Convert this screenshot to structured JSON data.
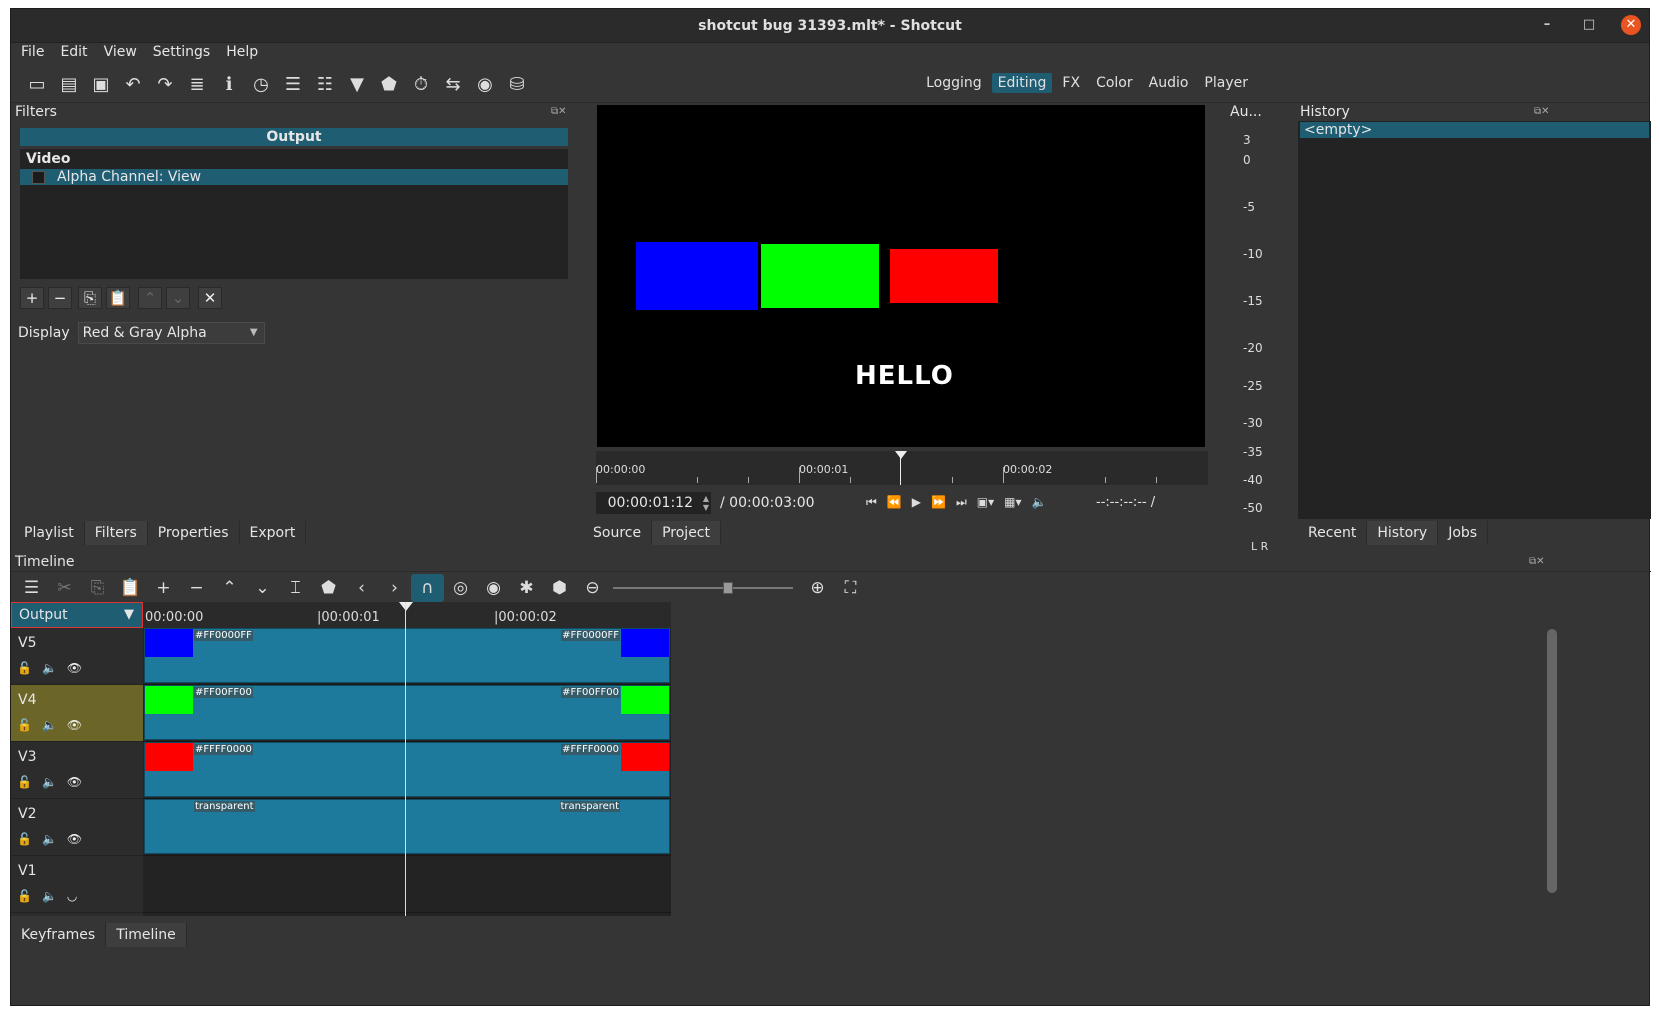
{
  "window": {
    "title": "shotcut bug 31393.mlt* - Shotcut",
    "min": "–",
    "max": "□",
    "close": "✕"
  },
  "menu": [
    "File",
    "Edit",
    "View",
    "Settings",
    "Help"
  ],
  "layouts": [
    "Logging",
    "Editing",
    "FX",
    "Color",
    "Audio",
    "Player"
  ],
  "filters": {
    "title": "Filters",
    "output_label": "Output",
    "section": "Video",
    "item": "Alpha Channel: View",
    "display_label": "Display",
    "display_value": "Red & Gray Alpha"
  },
  "left_tabs": [
    "Playlist",
    "Filters",
    "Properties",
    "Export"
  ],
  "player": {
    "preview_text": "HELLO",
    "ruler_labels": [
      "00:00:00",
      "00:00:01",
      "00:00:02"
    ],
    "timecode": "00:00:01:12",
    "duration": "/ 00:00:03:00",
    "inout": "--:--:--:-- /"
  },
  "player_tabs": [
    "Source",
    "Project"
  ],
  "audio": {
    "title": "Au...",
    "scale": [
      "3",
      "0",
      "-5",
      "-10",
      "-15",
      "-20",
      "-25",
      "-30",
      "-35",
      "-40",
      "-50"
    ],
    "lr": "L  R"
  },
  "history": {
    "title": "History",
    "item": "<empty>"
  },
  "right_tabs": [
    "Recent",
    "History",
    "Jobs"
  ],
  "timeline": {
    "title": "Timeline",
    "output_label": "Output",
    "ruler_labels": [
      "00:00:00",
      "|00:00:01",
      "|00:00:02"
    ],
    "tracks": [
      {
        "name": "V5",
        "left_label": "#FF0000FF",
        "right_label": "#FF0000FF",
        "color": "#0000ff"
      },
      {
        "name": "V4",
        "left_label": "#FF00FF00",
        "right_label": "#FF00FF00",
        "color": "#00ff00"
      },
      {
        "name": "V3",
        "left_label": "#FFFF0000",
        "right_label": "#FFFF0000",
        "color": "#ff0000"
      },
      {
        "name": "V2",
        "left_label": "transparent",
        "right_label": "transparent",
        "color": ""
      },
      {
        "name": "V1"
      }
    ]
  },
  "bottom_tabs": [
    "Keyframes",
    "Timeline"
  ],
  "colors": {
    "accent": "#1f5d73",
    "selected_track": "#6b6527",
    "clip": "#1d7a9c"
  }
}
